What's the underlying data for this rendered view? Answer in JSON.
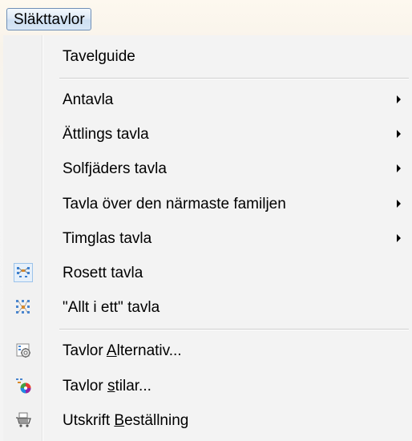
{
  "menubar": {
    "title": "Släkttavlor"
  },
  "menu": {
    "items": [
      {
        "label": "Tavelguide",
        "submenu": false,
        "icon": null
      },
      {
        "label": "Antavla",
        "submenu": true,
        "icon": null
      },
      {
        "label": "Ättlings tavla",
        "submenu": true,
        "icon": null
      },
      {
        "label": "Solfjäders tavla",
        "submenu": true,
        "icon": null
      },
      {
        "label": "Tavla över den närmaste familjen",
        "submenu": true,
        "icon": null
      },
      {
        "label": "Timglas tavla",
        "submenu": true,
        "icon": null
      },
      {
        "label": "Rosett tavla",
        "submenu": false,
        "icon": "bowtie-chart-icon",
        "checked": true
      },
      {
        "label": "\"Allt i ett\" tavla",
        "submenu": false,
        "icon": "all-in-one-chart-icon"
      },
      {
        "label_pre": "Tavlor ",
        "label_mn": "A",
        "label_post": "lternativ...",
        "submenu": false,
        "icon": "chart-options-icon"
      },
      {
        "label_pre": "Tavlor ",
        "label_mn": "s",
        "label_post": "tilar...",
        "submenu": false,
        "icon": "chart-styles-icon"
      },
      {
        "label_pre": "Utskrift ",
        "label_mn": "B",
        "label_post": "eställning",
        "submenu": false,
        "icon": "print-order-icon"
      }
    ]
  },
  "colors": {
    "menubar_active_border": "#6f8fb6",
    "menu_background": "#f3f3f3",
    "separator": "#cfcfcf",
    "checked_icon_border": "#9cc3ea"
  }
}
